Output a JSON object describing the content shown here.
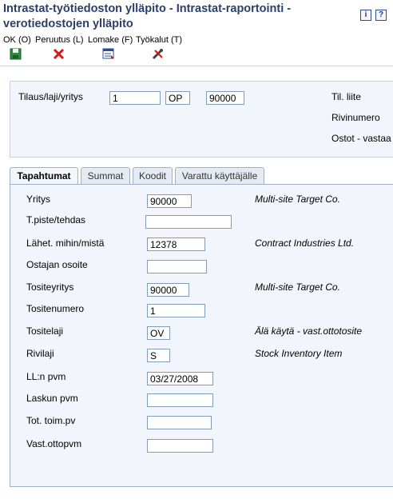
{
  "window": {
    "title_line1": "Intrastat-työtiedoston ylläpito - Intrastat-raportointi -",
    "title_line2": "verotiedostojen ylläpito",
    "info_icon": "i",
    "help_icon": "?"
  },
  "toolbar": {
    "ok": "OK (O)",
    "cancel": "Peruutus (L)",
    "form": "Lomake (F)",
    "tools": "Työkalut (T)"
  },
  "header": {
    "order_label": "Tilaus/laji/yritys",
    "order_number": "1",
    "order_type": "OP",
    "order_company": "90000",
    "attachment_label": "Til. liite",
    "line_number_label": "Rivinumero",
    "purchases_label": "Ostot - vastaa"
  },
  "tabs": [
    "Tapahtumat",
    "Summat",
    "Koodit",
    "Varattu käyttäjälle"
  ],
  "form": {
    "company": {
      "label": "Yritys",
      "value": "90000",
      "desc": "Multi-site Target Co."
    },
    "point": {
      "label": "T.piste/tehdas",
      "value": "",
      "desc": ""
    },
    "ship": {
      "label": "Lähet. mihin/mistä",
      "value": "12378",
      "desc": "Contract Industries Ltd."
    },
    "buyer_address": {
      "label": "Ostajan osoite",
      "value": "",
      "desc": ""
    },
    "doc_company": {
      "label": "Tositeyritys",
      "value": "90000",
      "desc": "Multi-site Target Co."
    },
    "doc_number": {
      "label": "Tositenumero",
      "value": "1",
      "desc": ""
    },
    "doc_type": {
      "label": "Tositelaji",
      "value": "OV",
      "desc": "Älä käytä - vast.ottotosite"
    },
    "line_type": {
      "label": "Rivilaji",
      "value": "S",
      "desc": "Stock Inventory Item"
    },
    "gl_date": {
      "label": "LL:n pvm",
      "value": "03/27/2008",
      "desc": ""
    },
    "invoice_date": {
      "label": "Laskun pvm",
      "value": "",
      "desc": ""
    },
    "delivery_date": {
      "label": "Tot. toim.pv",
      "value": "",
      "desc": ""
    },
    "receipt_date": {
      "label": "Vast.ottopvm",
      "value": "",
      "desc": ""
    }
  }
}
